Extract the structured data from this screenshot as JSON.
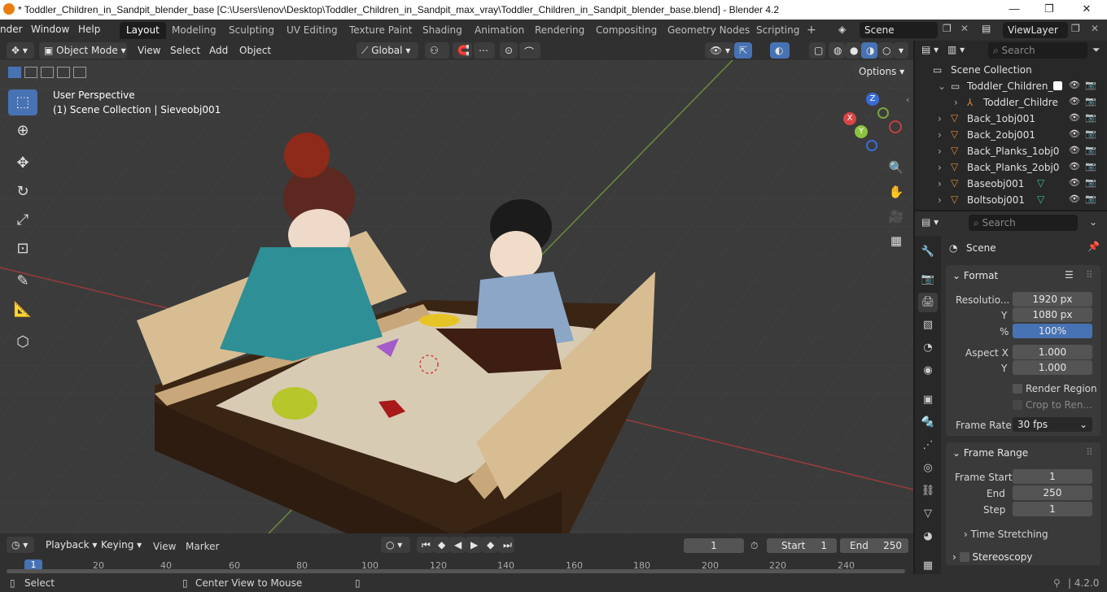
{
  "titlebar": {
    "title": "* Toddler_Children_in_Sandpit_blender_base [C:\\Users\\lenov\\Desktop\\Toddler_Children_in_Sandpit_max_vray\\Toddler_Children_in_Sandpit_blender_base.blend] - Blender 4.2"
  },
  "menu": {
    "render": "nder",
    "window": "Window",
    "help": "Help"
  },
  "workspaces": [
    "Layout",
    "Modeling",
    "Sculpting",
    "UV Editing",
    "Texture Paint",
    "Shading",
    "Animation",
    "Rendering",
    "Compositing",
    "Geometry Nodes",
    "Scripting"
  ],
  "scene": {
    "name": "Scene",
    "view_layer": "ViewLayer"
  },
  "viewport_header": {
    "mode": "Object Mode",
    "view": "View",
    "select": "Select",
    "add": "Add",
    "object": "Object",
    "transform": "Global",
    "options": "Options"
  },
  "viewport": {
    "perspective": "User Perspective",
    "collection_info": "(1) Scene Collection | Sieveobj001"
  },
  "outliner": {
    "search_placeholder": "Search",
    "root": "Scene Collection",
    "items": [
      {
        "name": "Toddler_Children_i"
      },
      {
        "name": "Toddler_Childre"
      },
      {
        "name": "Back_1obj001"
      },
      {
        "name": "Back_2obj001"
      },
      {
        "name": "Back_Planks_1obj0"
      },
      {
        "name": "Back_Planks_2obj0"
      },
      {
        "name": "Baseobj001"
      },
      {
        "name": "Boltsobj001"
      }
    ]
  },
  "properties": {
    "search_placeholder": "Search",
    "context": "Scene",
    "format": {
      "title": "Format",
      "resolution_label": "Resolutio...",
      "res_x": "1920 px",
      "y_label": "Y",
      "res_y": "1080 px",
      "pct_label": "%",
      "res_pct": "100%",
      "aspect_x_label": "Aspect X",
      "aspect_x": "1.000",
      "aspect_y_label": "Y",
      "aspect_y": "1.000",
      "render_region": "Render Region",
      "crop": "Crop to Ren...",
      "frame_rate_label": "Frame Rate",
      "frame_rate": "30 fps"
    },
    "frame_range": {
      "title": "Frame Range",
      "start_label": "Frame Start",
      "start": "1",
      "end_label": "End",
      "end": "250",
      "step_label": "Step",
      "step": "1"
    },
    "time_stretching": "Time Stretching",
    "stereoscopy": "Stereoscopy"
  },
  "timeline": {
    "playback": "Playback",
    "keying": "Keying",
    "view": "View",
    "marker": "Marker",
    "current_frame": "1",
    "start_label": "Start",
    "start": "1",
    "end_label": "End",
    "end": "250",
    "ruler": [
      "1",
      "20",
      "40",
      "60",
      "80",
      "100",
      "120",
      "140",
      "160",
      "180",
      "200",
      "220",
      "240"
    ]
  },
  "statusbar": {
    "select": "Select",
    "center": "Center View to Mouse",
    "version": "4.2.0"
  },
  "colors": {
    "accent": "#4772b3",
    "bg": "#1d1d1d",
    "panel": "#303030"
  }
}
